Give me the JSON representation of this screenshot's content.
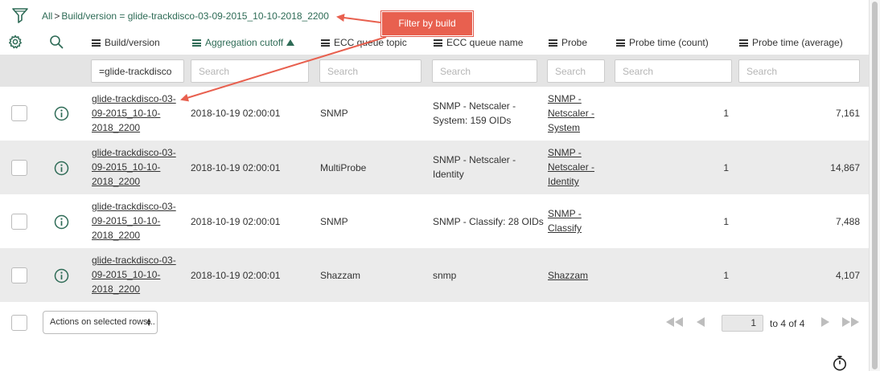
{
  "breadcrumb": {
    "root": "All",
    "separator": ">",
    "condition": "Build/version = glide-trackdisco-03-09-2015_10-10-2018_2200"
  },
  "annotation": {
    "callout": "Filter by build",
    "color": "#e8604f"
  },
  "columns": [
    {
      "label": "Build/version"
    },
    {
      "label": "Aggregation cutoff",
      "sorted": "ascending"
    },
    {
      "label": "ECC queue topic"
    },
    {
      "label": "ECC queue name"
    },
    {
      "label": "Probe"
    },
    {
      "label": "Probe time (count)"
    },
    {
      "label": "Probe time (average)"
    }
  ],
  "search": {
    "build_value": "=glide-trackdisco",
    "placeholder": "Search"
  },
  "rows": [
    {
      "build": [
        "glide-trackdisco-03-",
        "09-2015_10-10-",
        "2018_2200"
      ],
      "cutoff": "2018-10-19 02:00:01",
      "topic": "SNMP",
      "queue_name": [
        "SNMP - Netscaler -",
        "System: 159 OIDs"
      ],
      "probe": [
        "SNMP -",
        "Netscaler -",
        "System"
      ],
      "count": "1",
      "average": "7,161"
    },
    {
      "build": [
        "glide-trackdisco-03-",
        "09-2015_10-10-",
        "2018_2200"
      ],
      "cutoff": "2018-10-19 02:00:01",
      "topic": "MultiProbe",
      "queue_name": [
        "SNMP - Netscaler -",
        "Identity"
      ],
      "probe": [
        "SNMP -",
        "Netscaler -",
        "Identity"
      ],
      "count": "1",
      "average": "14,867"
    },
    {
      "build": [
        "glide-trackdisco-03-",
        "09-2015_10-10-",
        "2018_2200"
      ],
      "cutoff": "2018-10-19 02:00:01",
      "topic": "SNMP",
      "queue_name": [
        "SNMP - Classify: 28 OIDs"
      ],
      "probe": [
        "SNMP -",
        "Classify"
      ],
      "count": "1",
      "average": "7,488"
    },
    {
      "build": [
        "glide-trackdisco-03-",
        "09-2015_10-10-",
        "2018_2200"
      ],
      "cutoff": "2018-10-19 02:00:01",
      "topic": "Shazzam",
      "queue_name": [
        "snmp"
      ],
      "probe": [
        "Shazzam"
      ],
      "count": "1",
      "average": "4,107"
    }
  ],
  "footer": {
    "actions_label": "Actions on selected rows...",
    "page": "1",
    "total": "to 4 of 4"
  },
  "colors": {
    "accent": "#2e6b56",
    "row_alt": "#ebebeb",
    "search_row": "#e4e4e4"
  }
}
